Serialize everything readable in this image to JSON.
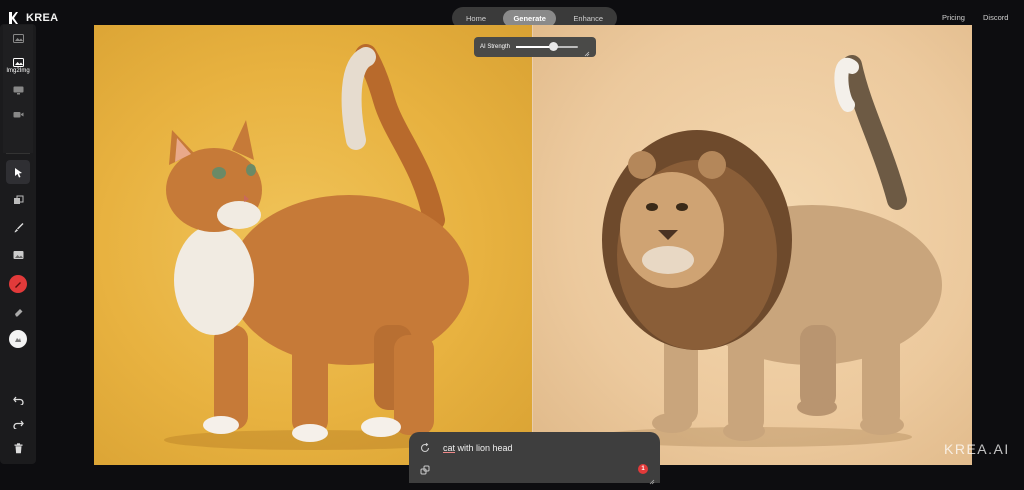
{
  "app": {
    "name": "KREA"
  },
  "nav": {
    "tabs": [
      {
        "label": "Home",
        "active": false
      },
      {
        "label": "Generate",
        "active": true
      },
      {
        "label": "Enhance",
        "active": false
      }
    ]
  },
  "top_links": {
    "pricing": "Pricing",
    "discord": "Discord"
  },
  "sidebar": {
    "mode_label": "Img2Img"
  },
  "strength": {
    "label": "AI Strength",
    "value": 0.6
  },
  "prompt": {
    "part1": "cat",
    "part2": " with lion head",
    "badge": "1"
  },
  "watermark": "KREA.AI",
  "colors": {
    "accent_red": "#e23a3a",
    "left_bg": "#e8b240",
    "right_bg": "#ecc99d"
  }
}
